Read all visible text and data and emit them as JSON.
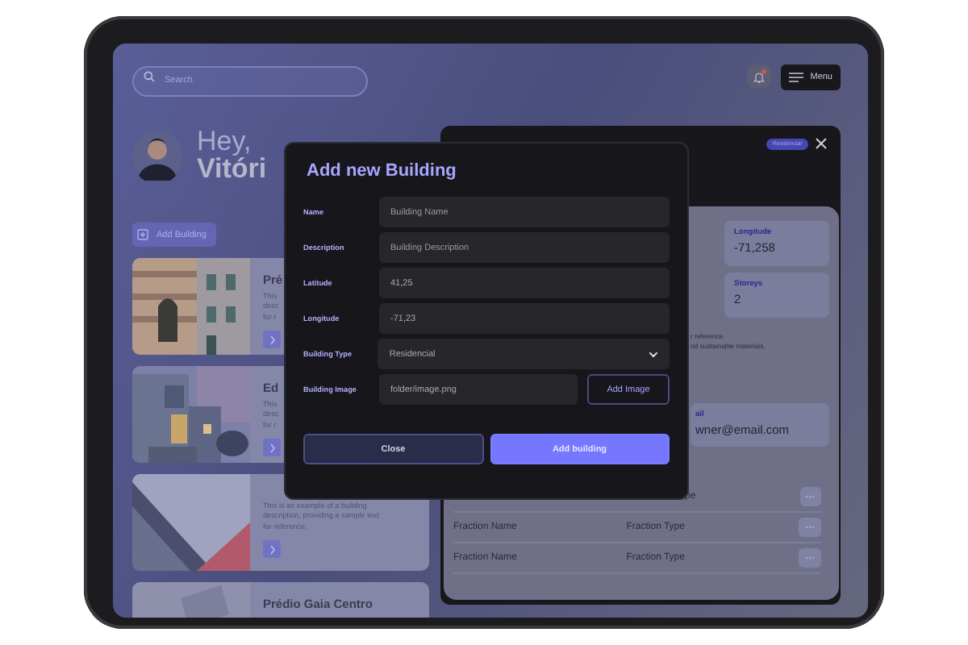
{
  "header": {
    "search": {
      "placeholder": "Search"
    },
    "notification": {
      "unread": true
    },
    "menu_button": "Menu"
  },
  "greeting": {
    "hello": "Hey,",
    "name": "Vitóri"
  },
  "add_button": "Add Building",
  "cards": [
    {
      "title": "Pré",
      "description": [
        "This",
        "desc",
        "for r"
      ]
    },
    {
      "title": "Ed",
      "description": [
        "This",
        "desc",
        "for r"
      ]
    },
    {
      "description": [
        "This is an example of a building",
        "description, providing a sample text",
        "for reference."
      ]
    },
    {
      "title": "Prédio Gaia Centro"
    }
  ],
  "detail_panel": {
    "badge": "Residencial",
    "tiles": [
      {
        "label": "Longitude",
        "value": "-71,258"
      },
      {
        "label": "Storeys",
        "value": "2"
      }
    ],
    "description": [
      "r reference.",
      "nd sustainable materials."
    ],
    "email": {
      "label": "ail",
      "value": "wner@email.com"
    },
    "fractions": [
      {
        "type": "pe"
      },
      {
        "name": "Fraction Name",
        "type": "Fraction Type"
      },
      {
        "name": "Fraction Name",
        "type": "Fraction Type"
      }
    ]
  },
  "modal": {
    "title": "Add new Building",
    "fields": [
      {
        "label": "Name",
        "kind": "text",
        "placeholder": "Building Name"
      },
      {
        "label": "Description",
        "kind": "text",
        "placeholder": "Building Description"
      },
      {
        "label": "Latitude",
        "kind": "text",
        "value": "41,25"
      },
      {
        "label": "Longitude",
        "kind": "text",
        "value": "-71,23"
      },
      {
        "label": "Building Type",
        "kind": "select",
        "value": "Residencial"
      },
      {
        "label": "Building Image",
        "kind": "file",
        "value": "folder/image.png",
        "button": "Add Image"
      }
    ],
    "buttons": [
      {
        "label": "Close",
        "kind": "secondary"
      },
      {
        "label": "Add building",
        "kind": "primary"
      }
    ]
  }
}
